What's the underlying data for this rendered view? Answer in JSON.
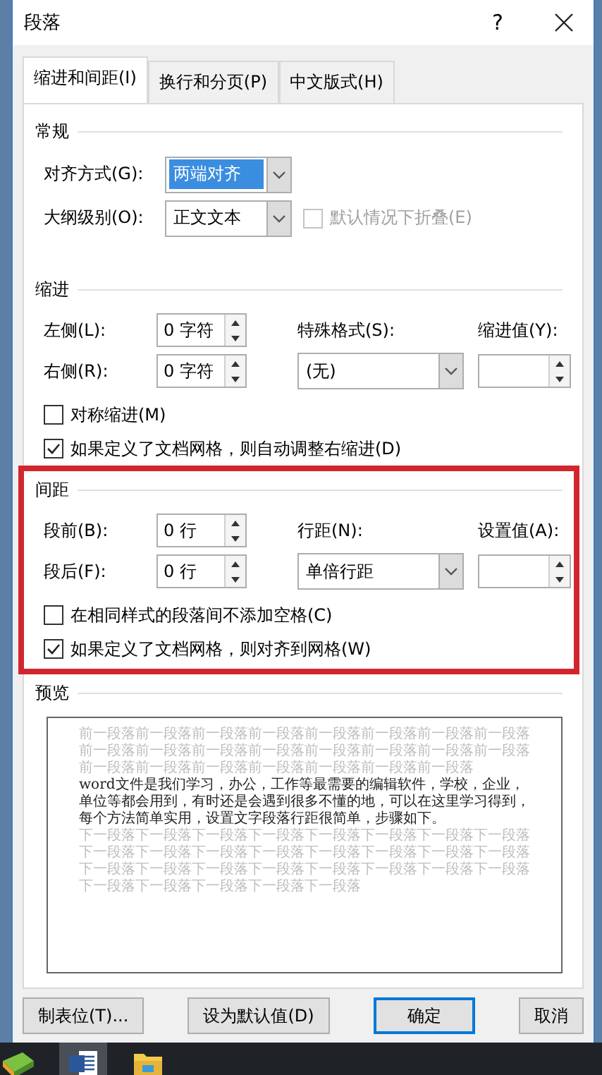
{
  "window": {
    "title": "段落",
    "help": "?"
  },
  "tabs": [
    {
      "label": "缩进和间距(I)",
      "selected": true
    },
    {
      "label": "换行和分页(P)",
      "selected": false
    },
    {
      "label": "中文版式(H)",
      "selected": false
    }
  ],
  "general": {
    "heading": "常规",
    "alignment": {
      "label": "对齐方式(G):",
      "value": "两端对齐",
      "focused": true
    },
    "outline_level": {
      "label": "大纲级别(O):",
      "value": "正文文本",
      "focused": false
    },
    "collapse": {
      "label": "默认情况下折叠(E)",
      "checked": false,
      "disabled": true
    }
  },
  "indentation": {
    "heading": "缩进",
    "highlighted": false,
    "left": {
      "label": "左侧(L):",
      "value": "0 字符"
    },
    "right": {
      "label": "右侧(R):",
      "value": "0 字符"
    },
    "special": {
      "label": "特殊格式(S):",
      "value": "(无)"
    },
    "by": {
      "label": "缩进值(Y):"
    },
    "checkboxes": [
      {
        "label": "对称缩进(M)",
        "checked": false
      },
      {
        "label": "如果定义了文档网格，则自动调整右缩进(D)",
        "checked": true
      }
    ]
  },
  "spacing": {
    "heading": "间距",
    "highlighted": true,
    "before": {
      "label": "段前(B):",
      "value": "0 行"
    },
    "after": {
      "label": "段后(F):",
      "value": "0 行"
    },
    "line_spacing": {
      "label": "行距(N):",
      "value": "单倍行距"
    },
    "at": {
      "label": "设置值(A):"
    },
    "checkboxes": [
      {
        "label": "在相同样式的段落间不添加空格(C)",
        "checked": false
      },
      {
        "label": "如果定义了文档网格，则对齐到网格(W)",
        "checked": true
      }
    ]
  },
  "preview": {
    "heading": "预览",
    "previous": "前一段落前一段落前一段落前一段落前一段落前一段落前一段落前一段落前一段落前一段落前一段落前一段落前一段落前一段落前一段落前一段落前一段落前一段落前一段落前一段落前一段落前一段落前一段落",
    "text": "word文件是我们学习，办公，工作等最需要的编辑软件，学校，企业，单位等都会用到，有时还是会遇到很多不懂的地，可以在这里学习得到，每个方法简单实用，设置文字段落行距很简单，步骤如下。",
    "following": "下一段落下一段落下一段落下一段落下一段落下一段落下一段落下一段落下一段落下一段落下一段落下一段落下一段落下一段落下一段落下一段落下一段落下一段落下一段落下一段落下一段落下一段落下一段落下一段落下一段落下一段落下一段落下一段落下一段落"
  },
  "buttons": [
    {
      "label": "制表位(T)...",
      "kind": "normal"
    },
    {
      "label": "设为默认值(D)",
      "kind": "normal"
    },
    {
      "label": "确定",
      "kind": "default"
    },
    {
      "label": "取消",
      "kind": "normal"
    }
  ]
}
